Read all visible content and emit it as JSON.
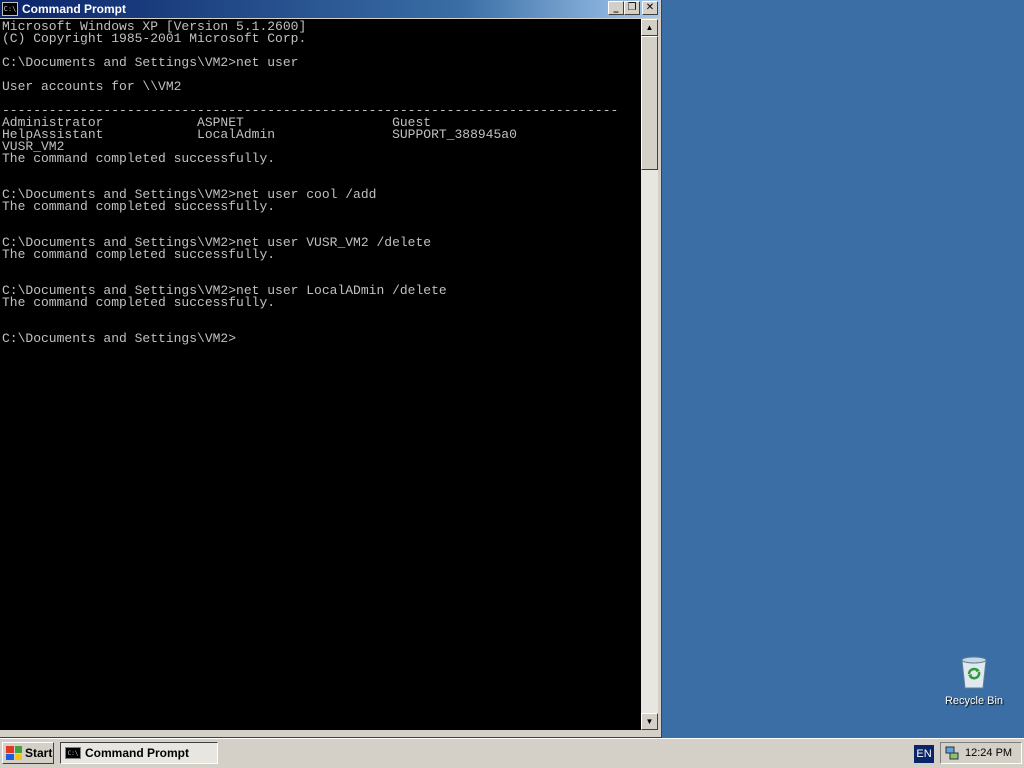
{
  "window": {
    "title": "Command Prompt",
    "icon": "cmd-icon",
    "icon_text": "C:\\",
    "buttons": {
      "minimize": "_",
      "restore": "❐",
      "close": "✕"
    }
  },
  "console": {
    "lines": [
      "Microsoft Windows XP [Version 5.1.2600]",
      "(C) Copyright 1985-2001 Microsoft Corp.",
      "",
      "C:\\Documents and Settings\\VM2>net user",
      "",
      "User accounts for \\\\VM2",
      "",
      "-------------------------------------------------------------------------------",
      "Administrator            ASPNET                   Guest",
      "HelpAssistant            LocalAdmin               SUPPORT_388945a0",
      "VUSR_VM2",
      "The command completed successfully.",
      "",
      "",
      "C:\\Documents and Settings\\VM2>net user cool /add",
      "The command completed successfully.",
      "",
      "",
      "C:\\Documents and Settings\\VM2>net user VUSR_VM2 /delete",
      "The command completed successfully.",
      "",
      "",
      "C:\\Documents and Settings\\VM2>net user LocalADmin /delete",
      "The command completed successfully.",
      "",
      "",
      "C:\\Documents and Settings\\VM2>"
    ]
  },
  "desktop": {
    "icons": [
      {
        "label": "Recycle Bin",
        "icon": "recycle-bin-icon"
      }
    ]
  },
  "taskbar": {
    "start_label": "Start",
    "tasks": [
      {
        "label": "Command Prompt",
        "icon": "cmd-icon"
      }
    ],
    "language": "EN",
    "clock": "12:24 PM"
  },
  "colors": {
    "desktop": "#3a6ea5",
    "console_bg": "#000000",
    "console_fg": "#c0c0c0",
    "titlebar_active": "#0a246a"
  }
}
